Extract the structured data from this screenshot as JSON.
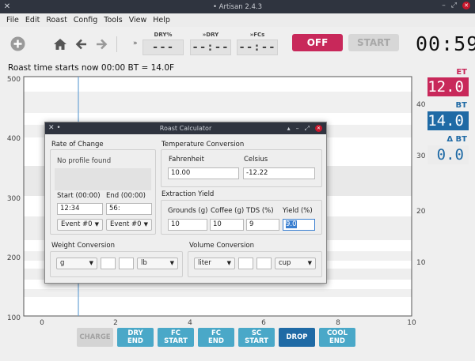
{
  "window": {
    "title": "• Artisan 2.4.3"
  },
  "menu": [
    "File",
    "Edit",
    "Roast",
    "Config",
    "Tools",
    "View",
    "Help"
  ],
  "toolbar": {
    "dry_label": "DRY%",
    "dry_value": "---",
    "todry_label": "»DRY",
    "todry_value": "--:--",
    "tofcs_label": "»FCs",
    "tofcs_value": "--:--",
    "off": "OFF",
    "start": "START",
    "timer": "00:59",
    "chevrons": "»"
  },
  "status": "Roast time starts now 00:00 BT = 14.0F",
  "plot": {
    "y_left": [
      "500",
      "400",
      "300",
      "200",
      "100"
    ],
    "y_right": [
      "40",
      "30",
      "20",
      "10"
    ],
    "x": [
      "0",
      "2",
      "4",
      "6",
      "8",
      "10"
    ]
  },
  "readouts": {
    "et_label": "ET",
    "et_value": "12.0",
    "bt_label": "BT",
    "bt_value": "14.0",
    "dbt_label": "Δ BT",
    "dbt_value": "0.0"
  },
  "events": [
    "CHARGE",
    "DRY\nEND",
    "FC\nSTART",
    "FC\nEND",
    "SC\nSTART",
    "DROP",
    "COOL\nEND"
  ],
  "colors": {
    "off": "#c8285a",
    "et": "#c8285a",
    "bt": "#1f6aa5",
    "event_btn": "#4aa8c8",
    "drop": "#1f6aa5"
  },
  "dialog": {
    "title": "Roast Calculator",
    "roc": {
      "title": "Rate of Change",
      "message": "No profile found",
      "start_label": "Start (00:00)",
      "end_label": "End (00:00)",
      "start_value": "12:34",
      "end_value": "56:",
      "start_event": "Event #0",
      "end_event": "Event #0"
    },
    "temp": {
      "title": "Temperature Conversion",
      "f_label": "Fahrenheit",
      "c_label": "Celsius",
      "f_value": "10.00",
      "c_value": "-12.22"
    },
    "extraction": {
      "title": "Extraction Yield",
      "grounds_label": "Grounds (g)",
      "coffee_label": "Coffee (g)",
      "tds_label": "TDS (%)",
      "yield_label": "Yield (%)",
      "grounds": "10",
      "coffee": "10",
      "tds": "9",
      "yield": "9.0"
    },
    "weight": {
      "title": "Weight Conversion",
      "from": "g",
      "to": "lb",
      "in": "",
      "out": ""
    },
    "volume": {
      "title": "Volume Conversion",
      "from": "liter",
      "to": "cup",
      "in": "",
      "out": ""
    }
  }
}
